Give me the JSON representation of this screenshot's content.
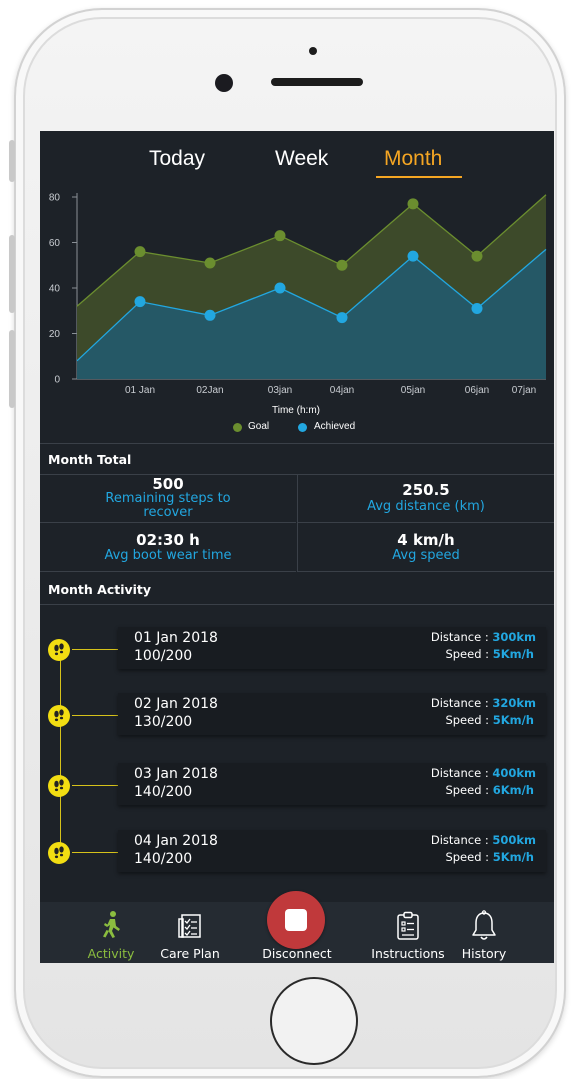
{
  "tabs": [
    {
      "label": "Today",
      "active": false
    },
    {
      "label": "Week",
      "active": false
    },
    {
      "label": "Month",
      "active": true
    }
  ],
  "colors": {
    "goal": "#6b8e2f",
    "achieved": "#22a7e0",
    "accent": "#f5a623",
    "disconnect": "#c0393b",
    "badge": "#f2dd12"
  },
  "chart_data": {
    "type": "area",
    "xlabel": "Time (h:m)",
    "ylabel": "",
    "ylim": [
      0,
      80
    ],
    "yticks": [
      0,
      20,
      40,
      60,
      80
    ],
    "categories": [
      "01 Jan",
      "02Jan",
      "03jan",
      "04jan",
      "05jan",
      "06jan",
      "07jan"
    ],
    "legend": "bottom",
    "series": [
      {
        "name": "Goal",
        "values": [
          32,
          56,
          51,
          63,
          50,
          77,
          54,
          81
        ],
        "x_positions": [
          "start",
          "01 Jan",
          "02Jan",
          "03jan",
          "04jan",
          "05jan",
          "06jan",
          "end"
        ]
      },
      {
        "name": "Achieved",
        "values": [
          8,
          34,
          28,
          40,
          27,
          54,
          31,
          57
        ],
        "x_positions": [
          "start",
          "01 Jan",
          "02Jan",
          "03jan",
          "04jan",
          "05jan",
          "06jan",
          "end"
        ]
      }
    ]
  },
  "month_total": {
    "title": "Month Total",
    "items": [
      {
        "value": "500",
        "label": "Remaining steps to recover"
      },
      {
        "value": "250.5",
        "label": "Avg distance (km)"
      },
      {
        "value": "02:30 h",
        "label": "Avg boot wear time"
      },
      {
        "value": "4 km/h",
        "label": "Avg speed"
      }
    ]
  },
  "month_activity": {
    "title": "Month Activity",
    "distance_label": "Distance : ",
    "speed_label": "Speed : ",
    "entries": [
      {
        "date": "01 Jan 2018",
        "steps": "100/200",
        "distance": "300km",
        "speed": "5Km/h"
      },
      {
        "date": "02 Jan 2018",
        "steps": "130/200",
        "distance": "320km",
        "speed": "5Km/h"
      },
      {
        "date": "03 Jan 2018",
        "steps": "140/200",
        "distance": "400km",
        "speed": "6Km/h"
      },
      {
        "date": "04 Jan 2018",
        "steps": "140/200",
        "distance": "500km",
        "speed": "5Km/h"
      }
    ]
  },
  "nav": {
    "activity": "Activity",
    "care_plan": "Care Plan",
    "disconnect": "Disconnect",
    "instructions": "Instructions",
    "history": "History"
  }
}
